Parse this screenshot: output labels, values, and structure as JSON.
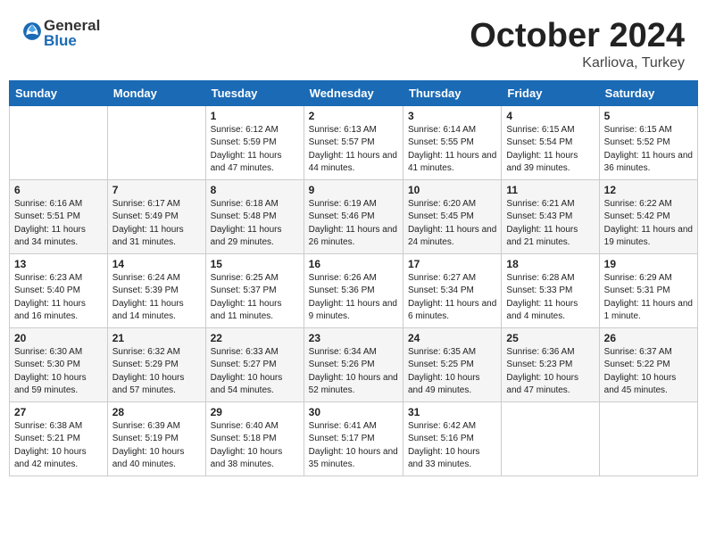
{
  "header": {
    "logo_general": "General",
    "logo_blue": "Blue",
    "month_year": "October 2024",
    "location": "Karliova, Turkey"
  },
  "weekdays": [
    "Sunday",
    "Monday",
    "Tuesday",
    "Wednesday",
    "Thursday",
    "Friday",
    "Saturday"
  ],
  "weeks": [
    [
      {
        "day": "",
        "sunrise": "",
        "sunset": "",
        "daylight": ""
      },
      {
        "day": "",
        "sunrise": "",
        "sunset": "",
        "daylight": ""
      },
      {
        "day": "1",
        "sunrise": "Sunrise: 6:12 AM",
        "sunset": "Sunset: 5:59 PM",
        "daylight": "Daylight: 11 hours and 47 minutes."
      },
      {
        "day": "2",
        "sunrise": "Sunrise: 6:13 AM",
        "sunset": "Sunset: 5:57 PM",
        "daylight": "Daylight: 11 hours and 44 minutes."
      },
      {
        "day": "3",
        "sunrise": "Sunrise: 6:14 AM",
        "sunset": "Sunset: 5:55 PM",
        "daylight": "Daylight: 11 hours and 41 minutes."
      },
      {
        "day": "4",
        "sunrise": "Sunrise: 6:15 AM",
        "sunset": "Sunset: 5:54 PM",
        "daylight": "Daylight: 11 hours and 39 minutes."
      },
      {
        "day": "5",
        "sunrise": "Sunrise: 6:15 AM",
        "sunset": "Sunset: 5:52 PM",
        "daylight": "Daylight: 11 hours and 36 minutes."
      }
    ],
    [
      {
        "day": "6",
        "sunrise": "Sunrise: 6:16 AM",
        "sunset": "Sunset: 5:51 PM",
        "daylight": "Daylight: 11 hours and 34 minutes."
      },
      {
        "day": "7",
        "sunrise": "Sunrise: 6:17 AM",
        "sunset": "Sunset: 5:49 PM",
        "daylight": "Daylight: 11 hours and 31 minutes."
      },
      {
        "day": "8",
        "sunrise": "Sunrise: 6:18 AM",
        "sunset": "Sunset: 5:48 PM",
        "daylight": "Daylight: 11 hours and 29 minutes."
      },
      {
        "day": "9",
        "sunrise": "Sunrise: 6:19 AM",
        "sunset": "Sunset: 5:46 PM",
        "daylight": "Daylight: 11 hours and 26 minutes."
      },
      {
        "day": "10",
        "sunrise": "Sunrise: 6:20 AM",
        "sunset": "Sunset: 5:45 PM",
        "daylight": "Daylight: 11 hours and 24 minutes."
      },
      {
        "day": "11",
        "sunrise": "Sunrise: 6:21 AM",
        "sunset": "Sunset: 5:43 PM",
        "daylight": "Daylight: 11 hours and 21 minutes."
      },
      {
        "day": "12",
        "sunrise": "Sunrise: 6:22 AM",
        "sunset": "Sunset: 5:42 PM",
        "daylight": "Daylight: 11 hours and 19 minutes."
      }
    ],
    [
      {
        "day": "13",
        "sunrise": "Sunrise: 6:23 AM",
        "sunset": "Sunset: 5:40 PM",
        "daylight": "Daylight: 11 hours and 16 minutes."
      },
      {
        "day": "14",
        "sunrise": "Sunrise: 6:24 AM",
        "sunset": "Sunset: 5:39 PM",
        "daylight": "Daylight: 11 hours and 14 minutes."
      },
      {
        "day": "15",
        "sunrise": "Sunrise: 6:25 AM",
        "sunset": "Sunset: 5:37 PM",
        "daylight": "Daylight: 11 hours and 11 minutes."
      },
      {
        "day": "16",
        "sunrise": "Sunrise: 6:26 AM",
        "sunset": "Sunset: 5:36 PM",
        "daylight": "Daylight: 11 hours and 9 minutes."
      },
      {
        "day": "17",
        "sunrise": "Sunrise: 6:27 AM",
        "sunset": "Sunset: 5:34 PM",
        "daylight": "Daylight: 11 hours and 6 minutes."
      },
      {
        "day": "18",
        "sunrise": "Sunrise: 6:28 AM",
        "sunset": "Sunset: 5:33 PM",
        "daylight": "Daylight: 11 hours and 4 minutes."
      },
      {
        "day": "19",
        "sunrise": "Sunrise: 6:29 AM",
        "sunset": "Sunset: 5:31 PM",
        "daylight": "Daylight: 11 hours and 1 minute."
      }
    ],
    [
      {
        "day": "20",
        "sunrise": "Sunrise: 6:30 AM",
        "sunset": "Sunset: 5:30 PM",
        "daylight": "Daylight: 10 hours and 59 minutes."
      },
      {
        "day": "21",
        "sunrise": "Sunrise: 6:32 AM",
        "sunset": "Sunset: 5:29 PM",
        "daylight": "Daylight: 10 hours and 57 minutes."
      },
      {
        "day": "22",
        "sunrise": "Sunrise: 6:33 AM",
        "sunset": "Sunset: 5:27 PM",
        "daylight": "Daylight: 10 hours and 54 minutes."
      },
      {
        "day": "23",
        "sunrise": "Sunrise: 6:34 AM",
        "sunset": "Sunset: 5:26 PM",
        "daylight": "Daylight: 10 hours and 52 minutes."
      },
      {
        "day": "24",
        "sunrise": "Sunrise: 6:35 AM",
        "sunset": "Sunset: 5:25 PM",
        "daylight": "Daylight: 10 hours and 49 minutes."
      },
      {
        "day": "25",
        "sunrise": "Sunrise: 6:36 AM",
        "sunset": "Sunset: 5:23 PM",
        "daylight": "Daylight: 10 hours and 47 minutes."
      },
      {
        "day": "26",
        "sunrise": "Sunrise: 6:37 AM",
        "sunset": "Sunset: 5:22 PM",
        "daylight": "Daylight: 10 hours and 45 minutes."
      }
    ],
    [
      {
        "day": "27",
        "sunrise": "Sunrise: 6:38 AM",
        "sunset": "Sunset: 5:21 PM",
        "daylight": "Daylight: 10 hours and 42 minutes."
      },
      {
        "day": "28",
        "sunrise": "Sunrise: 6:39 AM",
        "sunset": "Sunset: 5:19 PM",
        "daylight": "Daylight: 10 hours and 40 minutes."
      },
      {
        "day": "29",
        "sunrise": "Sunrise: 6:40 AM",
        "sunset": "Sunset: 5:18 PM",
        "daylight": "Daylight: 10 hours and 38 minutes."
      },
      {
        "day": "30",
        "sunrise": "Sunrise: 6:41 AM",
        "sunset": "Sunset: 5:17 PM",
        "daylight": "Daylight: 10 hours and 35 minutes."
      },
      {
        "day": "31",
        "sunrise": "Sunrise: 6:42 AM",
        "sunset": "Sunset: 5:16 PM",
        "daylight": "Daylight: 10 hours and 33 minutes."
      },
      {
        "day": "",
        "sunrise": "",
        "sunset": "",
        "daylight": ""
      },
      {
        "day": "",
        "sunrise": "",
        "sunset": "",
        "daylight": ""
      }
    ]
  ]
}
